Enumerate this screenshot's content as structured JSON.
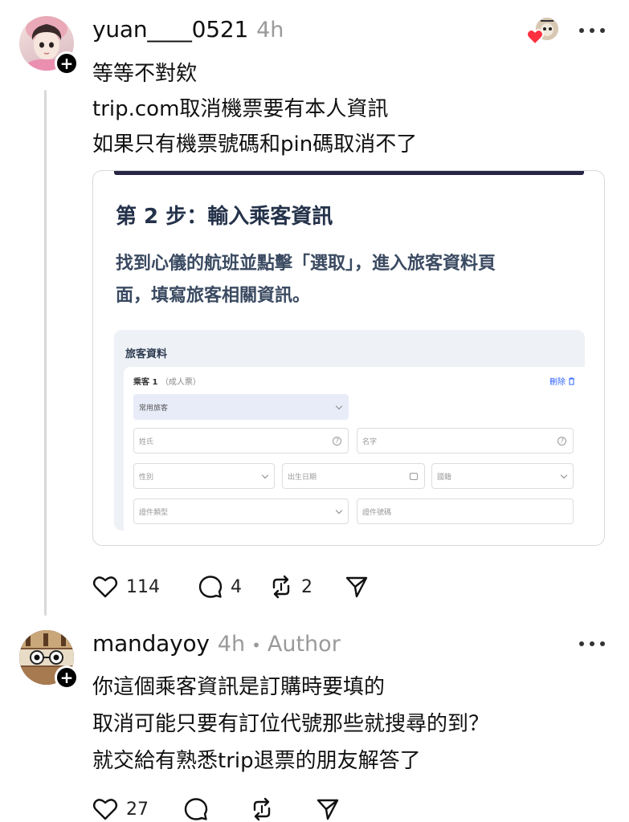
{
  "post1": {
    "username": "yuan____0521",
    "time": "4h",
    "lines": [
      "等等不對欸",
      "trip.com取消機票要有本人資訊",
      "如果只有機票號碼和pin碼取消不了"
    ],
    "image": {
      "step_title": "第 2 步：輸入乘客資訊",
      "desc_lines": [
        "找到心儀的航班並點擊「選取」，進入旅客資料頁",
        "面，填寫旅客相關資訊。"
      ],
      "form_title": "旅客資料",
      "passenger_label": "乘客 1",
      "passenger_sub": "（成人票）",
      "delete_label": "刪除",
      "frequent_traveler": "常用旅客",
      "surname_placeholder": "姓氏",
      "given_name_placeholder": "名字",
      "gender_placeholder": "性別",
      "dob_placeholder": "出生日期",
      "nationality_placeholder": "國籍",
      "id_type_placeholder": "證件類型",
      "id_number_placeholder": "證件號碼"
    },
    "likes": "114",
    "comments": "4",
    "reposts": "2"
  },
  "post2": {
    "username": "mandayoy",
    "time": "4h",
    "separator": "•",
    "author_label": "Author",
    "lines": [
      "你這個乘客資訊是訂購時要填的",
      "取消可能只要有訂位代號那些就搜尋的到？",
      "就交給有熟悉trip退票的朋友解答了"
    ],
    "likes": "27"
  },
  "colors": {
    "heart_red": "#ff3040",
    "secondary_text": "#9a9a9a",
    "card_title": "#24324a",
    "link_blue": "#3264ff"
  }
}
